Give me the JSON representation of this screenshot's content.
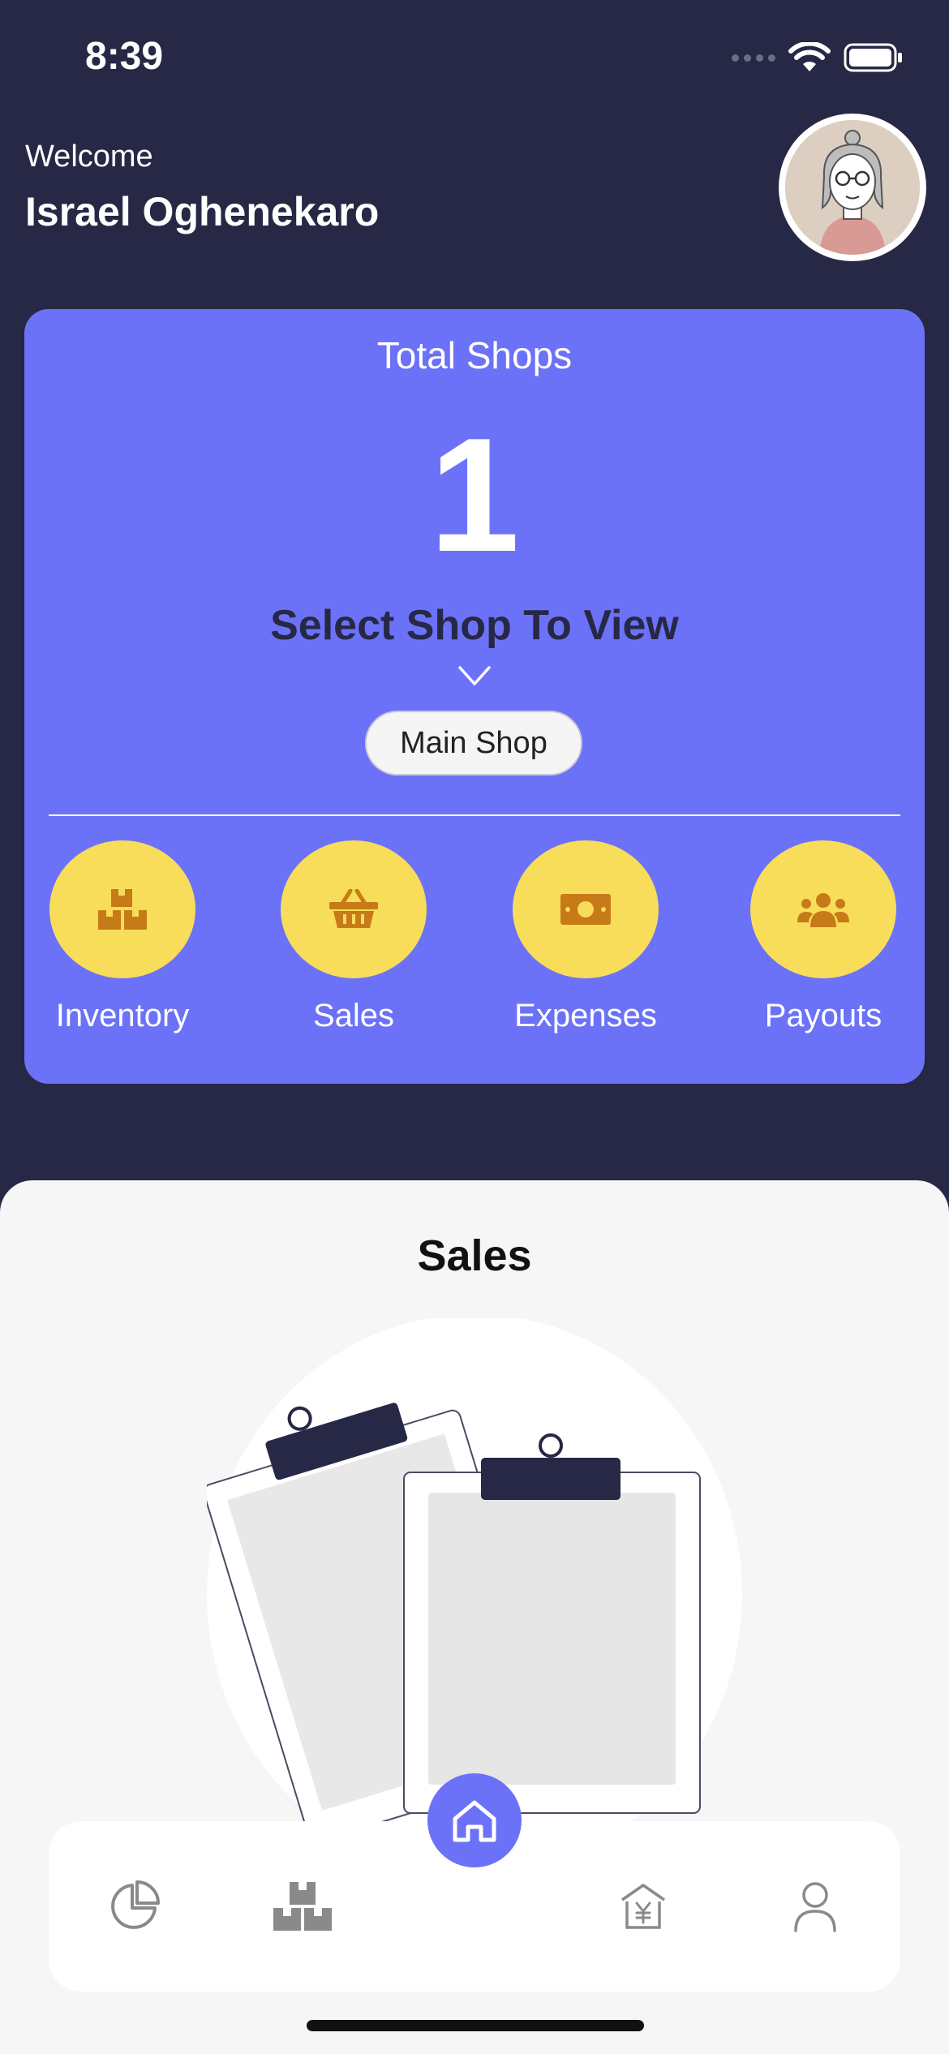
{
  "status_bar": {
    "time": "8:39"
  },
  "header": {
    "welcome": "Welcome",
    "user_name": "Israel Oghenekaro"
  },
  "card": {
    "title": "Total Shops",
    "count": "1",
    "select_label": "Select Shop To View",
    "selected_shop": "Main Shop",
    "actions": [
      {
        "label": "Inventory",
        "icon": "boxes-icon"
      },
      {
        "label": "Sales",
        "icon": "basket-icon"
      },
      {
        "label": "Expenses",
        "icon": "money-icon"
      },
      {
        "label": "Payouts",
        "icon": "users-icon"
      }
    ]
  },
  "sheet": {
    "title": "Sales"
  },
  "tabbar": {
    "tabs": [
      {
        "icon": "pie-chart-icon"
      },
      {
        "icon": "boxes-icon"
      },
      {
        "icon": "home-icon"
      },
      {
        "icon": "bank-icon"
      },
      {
        "icon": "user-icon"
      }
    ]
  },
  "colors": {
    "background": "#262845",
    "accent": "#6c72f7",
    "action_circle": "#f8dd5a",
    "action_icon": "#c77a18"
  }
}
